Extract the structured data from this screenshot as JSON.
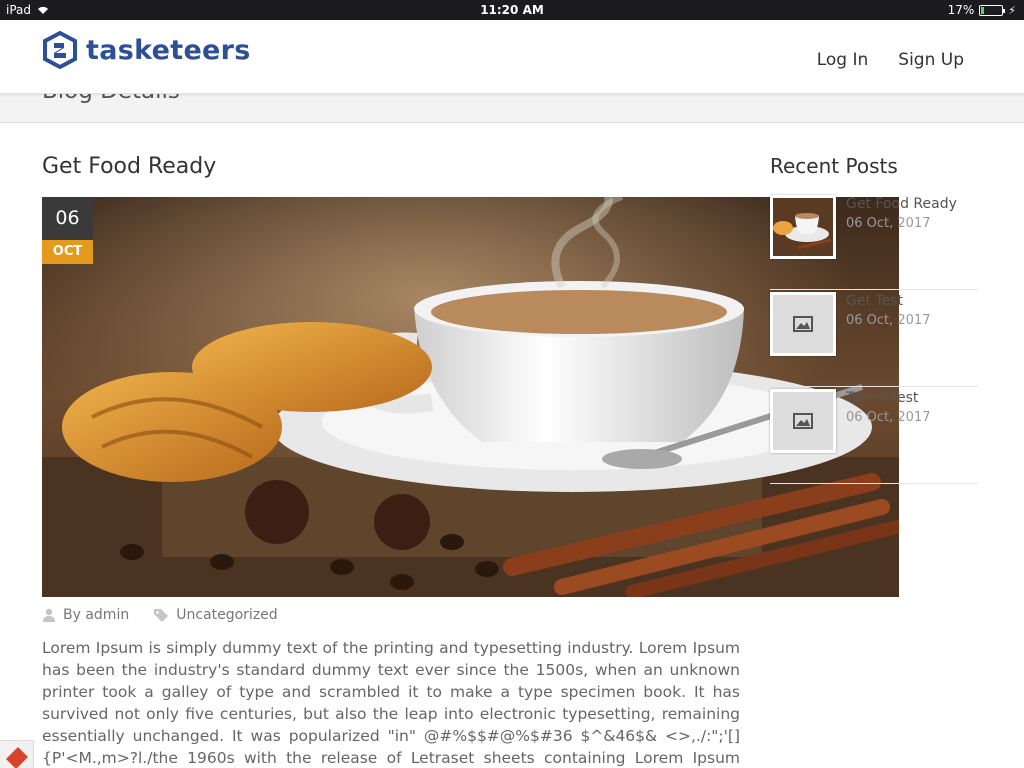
{
  "status_bar": {
    "device": "iPad",
    "time": "11:20 AM",
    "battery": "17%"
  },
  "header": {
    "logo_text": "tasketeers",
    "nav": {
      "login": "Log In",
      "signup": "Sign Up"
    }
  },
  "subbar": {
    "title": "Blog Details"
  },
  "post": {
    "title": "Get Food Ready",
    "date_day": "06",
    "date_month": "OCT",
    "author": "By admin",
    "category": "Uncategorized",
    "body": "Lorem Ipsum is simply dummy text of the printing and typesetting industry. Lorem Ipsum has been the industry's standard dummy text ever since the 1500s, when an unknown printer took a galley of type and scrambled it to make a type specimen book. It has survived not only five centuries, but also the leap into electronic typesetting, remaining essentially unchanged. It was popularized \"in\" @#%$$#@%$#36 $^&46$& <>,./:\";'[]{P'<M.,m>?l./the 1960s with the release of Letraset sheets containing Lorem Ipsum passages, and more recently with desktop"
  },
  "sidebar": {
    "title": "Recent Posts",
    "items": [
      {
        "name": "Get Food Ready",
        "date": "06 Oct, 2017",
        "icon": "coffee-thumbnail"
      },
      {
        "name": "Get Test",
        "date": "06 Oct, 2017",
        "icon": "image-placeholder-icon"
      },
      {
        "name": "Tahini Test",
        "date": "06 Oct, 2017",
        "icon": "image-placeholder-icon"
      }
    ]
  },
  "colors": {
    "brand": "#2d4f96",
    "date_month_bg": "#e49b1d",
    "date_day_bg": "#3a3a3a"
  }
}
